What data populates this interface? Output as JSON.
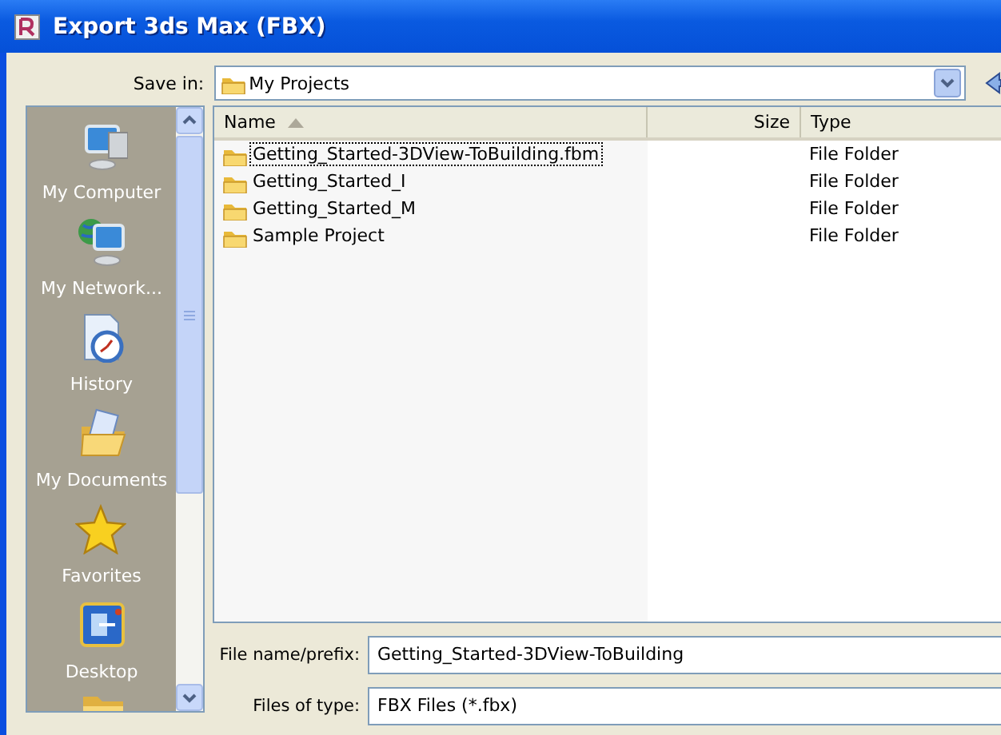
{
  "window": {
    "title": "Export 3ds Max (FBX)"
  },
  "save_in": {
    "label": "Save in:",
    "value": "My Projects"
  },
  "places": [
    {
      "label": "My Computer",
      "kind": "computer"
    },
    {
      "label": "My Network...",
      "kind": "network"
    },
    {
      "label": "History",
      "kind": "history"
    },
    {
      "label": "My Documents",
      "kind": "documents"
    },
    {
      "label": "Favorites",
      "kind": "favorites"
    },
    {
      "label": "Desktop",
      "kind": "desktop"
    },
    {
      "kind": "folder"
    }
  ],
  "columns": [
    {
      "label": "Name",
      "sorted": true
    },
    {
      "label": "Size",
      "sorted": false
    },
    {
      "label": "Type",
      "sorted": false
    }
  ],
  "rows": [
    {
      "name": "Getting_Started-3DView-ToBuilding.fbm",
      "type": "File Folder",
      "focused": true
    },
    {
      "name": "Getting_Started_I",
      "type": "File Folder",
      "focused": false
    },
    {
      "name": "Getting_Started_M",
      "type": "File Folder",
      "focused": false
    },
    {
      "name": "Sample Project",
      "type": "File Folder",
      "focused": false
    }
  ],
  "file_name": {
    "label": "File name/prefix:",
    "value": "Getting_Started-3DView-ToBuilding"
  },
  "file_type": {
    "label": "Files of type:",
    "value": "FBX Files  (*.fbx)"
  }
}
